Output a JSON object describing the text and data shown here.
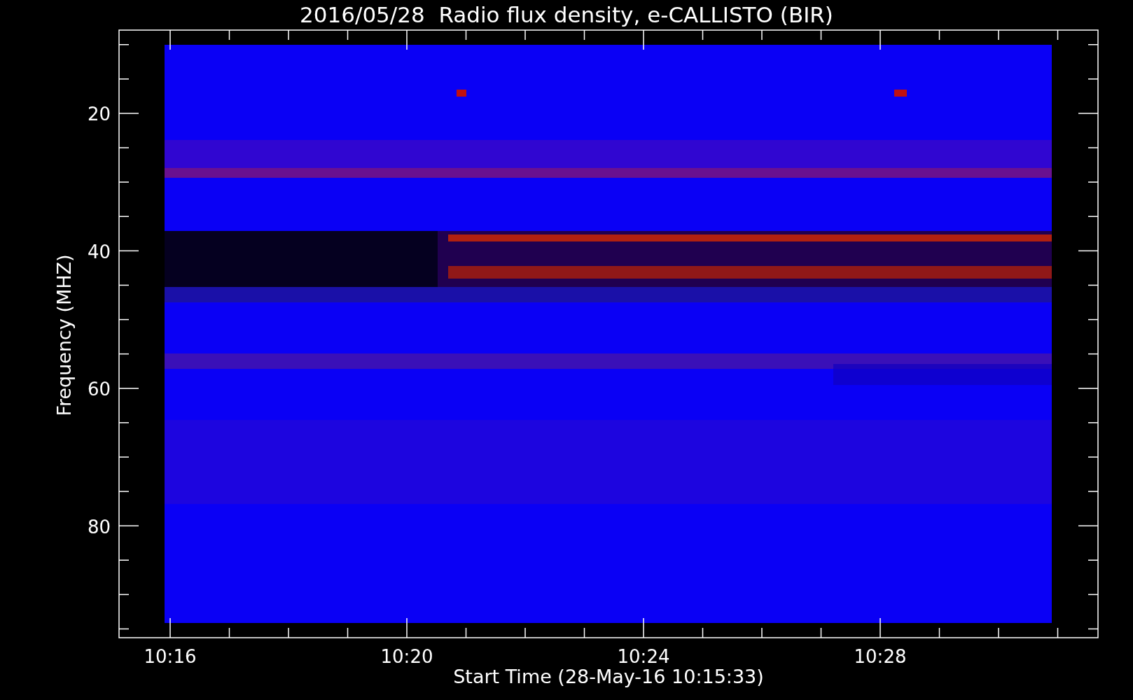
{
  "title": "2016/05/28  Radio flux density, e-CALLISTO (BIR)",
  "y_axis": {
    "label": "Frequency (MHZ)",
    "ticks": [
      "20",
      "40",
      "60",
      "80"
    ]
  },
  "x_axis": {
    "label": "Start Time (28-May-16 10:15:33)",
    "ticks": [
      "10:16",
      "10:20",
      "10:24",
      "10:28"
    ]
  }
}
